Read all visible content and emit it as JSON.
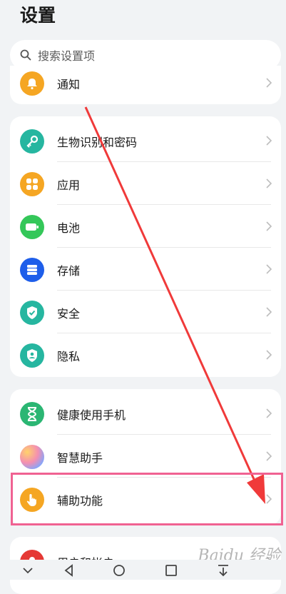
{
  "header": {
    "title": "设置"
  },
  "search": {
    "placeholder": "搜索设置项"
  },
  "partial_top_item": {
    "label": "通知",
    "icon": "bell-icon",
    "color": "#f5a623"
  },
  "group1": [
    {
      "label": "生物识别和密码",
      "icon": "key-icon",
      "color": "#26b6a0"
    },
    {
      "label": "应用",
      "icon": "apps-grid-icon",
      "color": "#f5a623"
    },
    {
      "label": "电池",
      "icon": "battery-icon",
      "color": "#34c759"
    },
    {
      "label": "存储",
      "icon": "storage-icon",
      "color": "#1e5eea"
    },
    {
      "label": "安全",
      "icon": "shield-check-icon",
      "color": "#26b6a0"
    },
    {
      "label": "隐私",
      "icon": "privacy-shield-icon",
      "color": "#26b6a0"
    }
  ],
  "group2": [
    {
      "label": "健康使用手机",
      "icon": "hourglass-icon",
      "color": "#2bb673"
    },
    {
      "label": "智慧助手",
      "icon": "assistant-icon",
      "color": "#b38af0"
    },
    {
      "label": "辅助功能",
      "icon": "hand-tap-icon",
      "color": "#f5a623"
    }
  ],
  "partial_bottom_item": {
    "label": "用户和帐户",
    "icon": "user-icon",
    "color": "#e53935"
  },
  "annotation": {
    "highlight_color": "#f06292",
    "arrow_color": "#f03a3a"
  },
  "watermark": {
    "text": "Baidu 经验"
  }
}
